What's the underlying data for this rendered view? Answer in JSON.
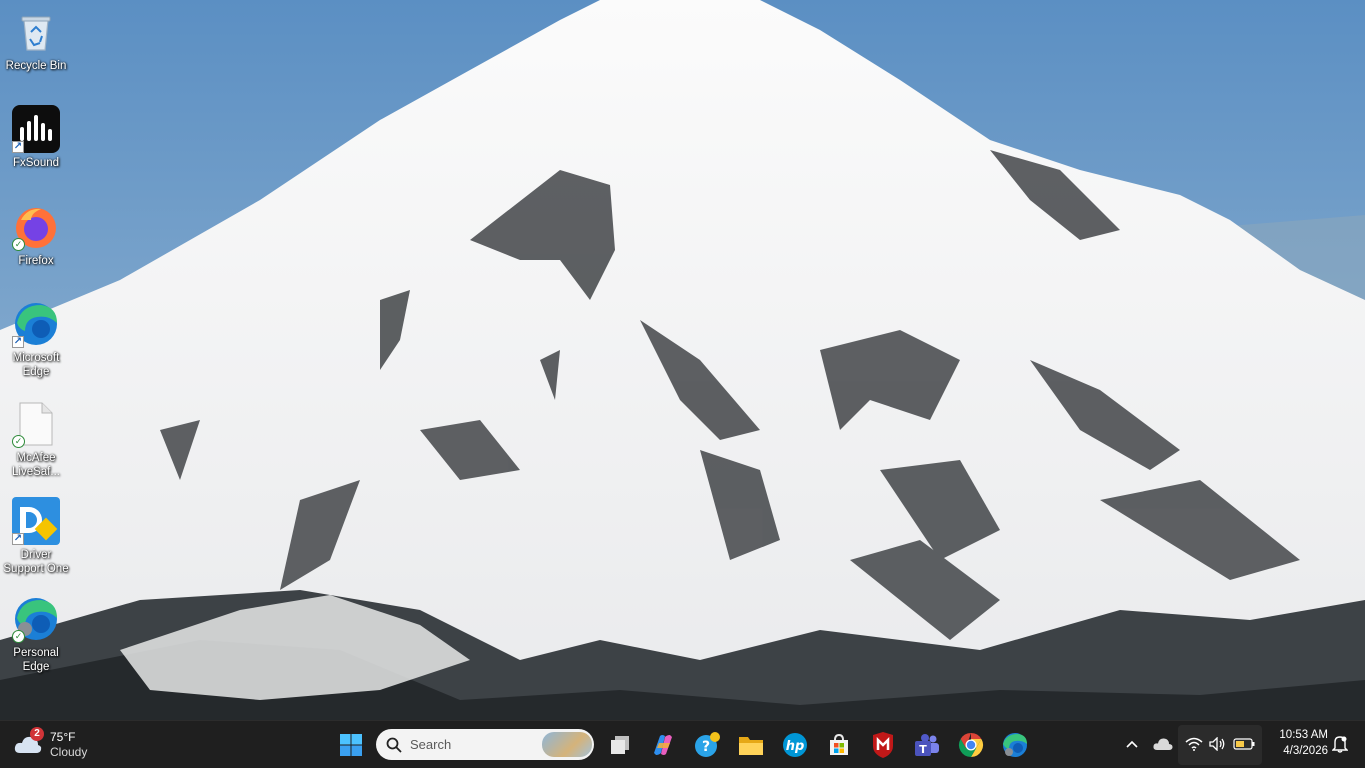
{
  "desktop": {
    "icons": [
      {
        "label": "Recycle Bin"
      },
      {
        "label": "FxSound"
      },
      {
        "label": "Firefox"
      },
      {
        "label": "Microsoft Edge"
      },
      {
        "label": "McAfee LiveSaf..."
      },
      {
        "label": "Driver Support One"
      },
      {
        "label": "Personal Edge"
      }
    ]
  },
  "taskbar": {
    "weather": {
      "temp": "75°F",
      "condition": "Cloudy",
      "badge": "2"
    },
    "search": {
      "placeholder": "Search"
    },
    "pinned_apps": [
      "start-icon",
      "task-view-icon",
      "copilot-icon",
      "get-help-icon",
      "file-explorer-icon",
      "hp-icon",
      "microsoft-store-icon",
      "mcafee-icon",
      "teams-icon",
      "chrome-icon",
      "edge-icon"
    ],
    "clock": {
      "time": "10:53 AM",
      "date": "4/3/2026"
    }
  },
  "colors": {
    "taskbar_bg": "#1f1f1f",
    "sky": "#6f9fcc",
    "accent": "#0078d4"
  }
}
